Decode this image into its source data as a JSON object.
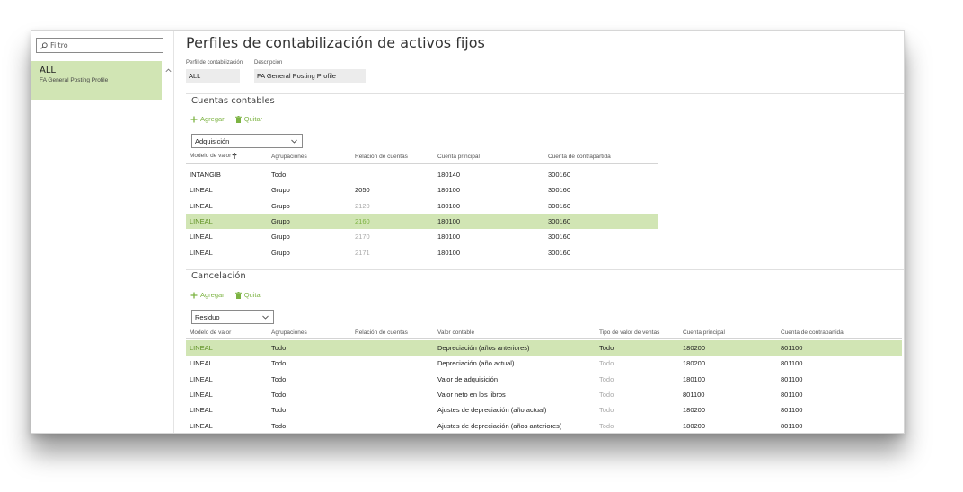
{
  "filter": {
    "placeholder": "Filtro"
  },
  "list": {
    "items": [
      {
        "code": "ALL",
        "description": "FA General Posting Profile"
      }
    ]
  },
  "page": {
    "title": "Perfiles de contabilización de activos fijos",
    "fields": [
      {
        "label": "Perfil de contabilización",
        "value": "ALL"
      },
      {
        "label": "Descripción",
        "value": "FA General Posting Profile"
      }
    ]
  },
  "accounts": {
    "title": "Cuentas contables",
    "add_label": "Agregar",
    "remove_label": "Quitar",
    "selector": "Adquisición",
    "columns": [
      "Modelo de valor",
      "Agrupaciones",
      "Relación de cuentas",
      "Cuenta principal",
      "Cuenta de contrapartida"
    ],
    "rows": [
      [
        "INTANGIB",
        "Todo",
        "",
        "180140",
        "300160"
      ],
      [
        "LINEAL",
        "Grupo",
        "2050",
        "180100",
        "300160"
      ],
      [
        "LINEAL",
        "Grupo",
        "2120",
        "180100",
        "300160"
      ],
      [
        "LINEAL",
        "Grupo",
        "2160",
        "180100",
        "300160"
      ],
      [
        "LINEAL",
        "Grupo",
        "2170",
        "180100",
        "300160"
      ],
      [
        "LINEAL",
        "Grupo",
        "2171",
        "180100",
        "300160"
      ]
    ],
    "selected_row": 3,
    "dim_relation_rows": [
      2,
      3,
      4,
      5
    ]
  },
  "disposal": {
    "title": "Cancelación",
    "add_label": "Agregar",
    "remove_label": "Quitar",
    "selector": "Residuo",
    "columns": [
      "Modelo de valor",
      "Agrupaciones",
      "Relación de cuentas",
      "Valor contable",
      "Tipo de valor de ventas",
      "Cuenta principal",
      "Cuenta de contrapartida"
    ],
    "rows": [
      [
        "LINEAL",
        "Todo",
        "",
        "Depreciación (años anteriores)",
        "Todo",
        "180200",
        "801100"
      ],
      [
        "LINEAL",
        "Todo",
        "",
        "Depreciación (año actual)",
        "Todo",
        "180200",
        "801100"
      ],
      [
        "LINEAL",
        "Todo",
        "",
        "Valor de adquisición",
        "Todo",
        "180100",
        "801100"
      ],
      [
        "LINEAL",
        "Todo",
        "",
        "Valor neto en los libros",
        "Todo",
        "801100",
        "801100"
      ],
      [
        "LINEAL",
        "Todo",
        "",
        "Ajustes de depreciación (año actual)",
        "Todo",
        "180200",
        "801100"
      ],
      [
        "LINEAL",
        "Todo",
        "",
        "Ajustes de depreciación (años anteriores)",
        "Todo",
        "180200",
        "801100"
      ]
    ],
    "selected_row": 0
  },
  "colors": {
    "accent": "#7cb342",
    "selection": "#d1e5b4"
  },
  "icons": [
    "search-icon",
    "chevron-up-icon",
    "add-icon",
    "trash-icon",
    "chevron-down-icon",
    "sort-ascending-icon"
  ]
}
